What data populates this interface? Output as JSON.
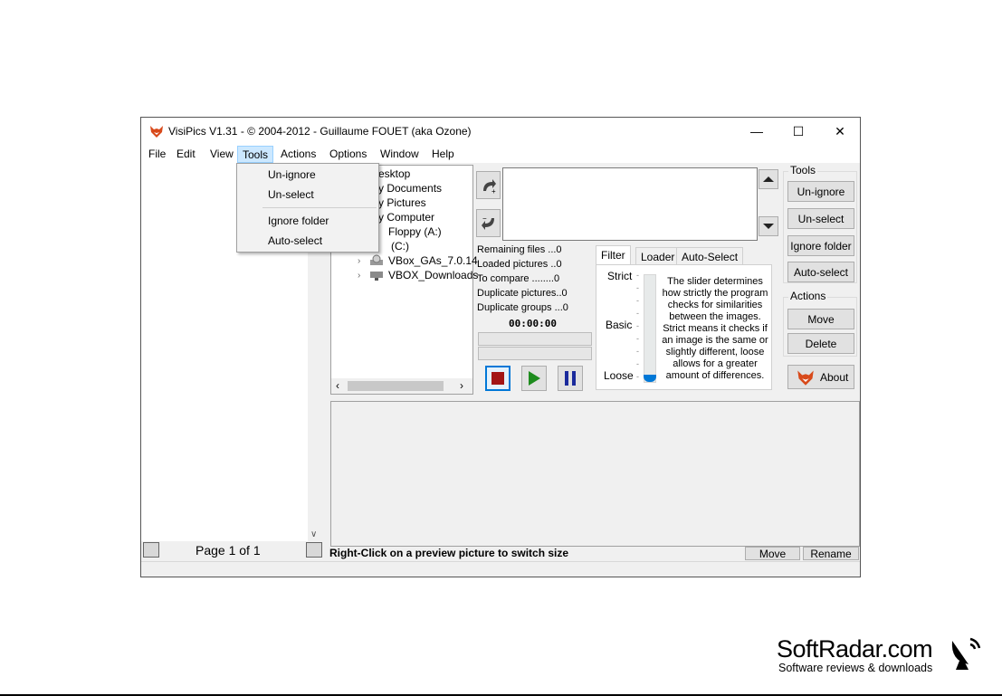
{
  "window": {
    "title": "VisiPics V1.31 - © 2004-2012 - Guillaume FOUET (aka Ozone)",
    "minimize": "—",
    "maximize": "☐",
    "close": "✕"
  },
  "menu": [
    "File",
    "Edit",
    "View",
    "Tools",
    "Actions",
    "Options",
    "Window",
    "Help"
  ],
  "menu_active": "Tools",
  "tools_menu": {
    "items": [
      "Un-ignore",
      "Un-select",
      "Ignore folder",
      "Auto-select"
    ]
  },
  "left": {
    "page_label": "Page 1 of 1",
    "scroll_arrow": "∨"
  },
  "tree": {
    "items": [
      "esktop",
      "y Documents",
      "y Pictures",
      "y Computer",
      "Floppy (A:)",
      "(C:)",
      "VBox_GAs_7.0.14",
      "VBOX_Downloads"
    ],
    "expanders": [
      "›",
      "›"
    ],
    "hscroll_left": "‹",
    "hscroll_right": "›"
  },
  "stats": {
    "remaining": "Remaining files ...0",
    "loaded": "Loaded pictures ..0",
    "compare": "To compare ........0",
    "dup_pictures": "Duplicate pictures..0",
    "dup_groups": "Duplicate groups ...0",
    "timer": "00:00:00"
  },
  "tabs": [
    "Filter",
    "Loader",
    "Auto-Select"
  ],
  "filter": {
    "levels": [
      "Strict",
      "Basic",
      "Loose"
    ],
    "slider_level": 1.0,
    "description": "The slider determines how strictly the program checks for similarities between the images. Strict means it checks if an image is the same or slightly different, loose allows for a greater amount of differences."
  },
  "tools_group": {
    "label": "Tools",
    "buttons": [
      "Un-ignore",
      "Un-select",
      "Ignore folder",
      "Auto-select"
    ]
  },
  "actions_group": {
    "label": "Actions",
    "buttons": [
      "Move",
      "Delete"
    ]
  },
  "about_label": "About",
  "status": {
    "text": "Right-Click on a preview picture to switch size",
    "move": "Move",
    "rename": "Rename"
  },
  "watermark": {
    "title": "SoftRadar.com",
    "subtitle": "Software reviews & downloads"
  },
  "colors": {
    "accent": "#0078d7",
    "stop": "#a31515",
    "play": "#1e8c1e",
    "pause": "#1a2a9c",
    "menu_highlight": "#cce8ff"
  }
}
